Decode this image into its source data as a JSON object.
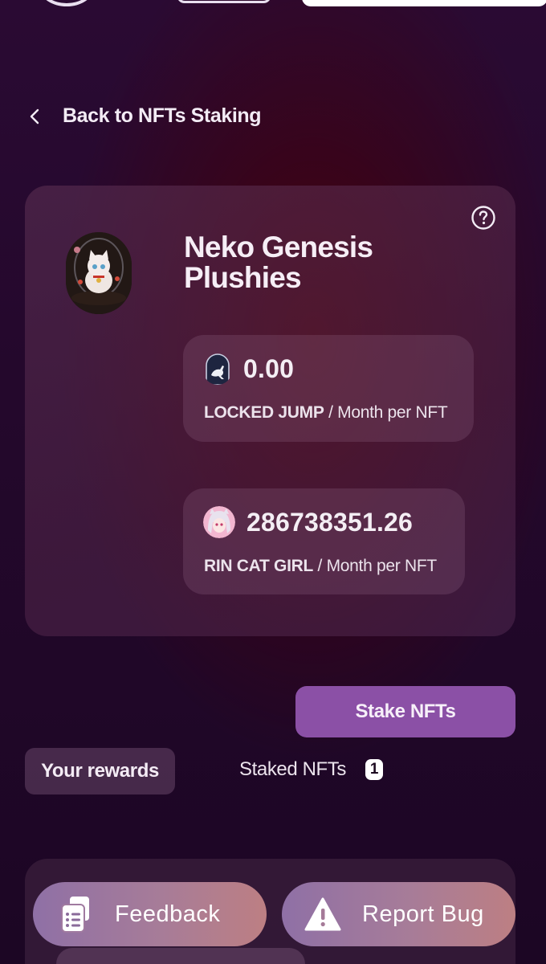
{
  "nav": {
    "back_label": "Back to NFTs Staking"
  },
  "collection": {
    "title": "Neko Genesis Plushies",
    "avatar_icon": "neko-cat-plush-avatar",
    "rewards": [
      {
        "amount": "0.00",
        "token": "LOCKED JUMP",
        "period": " / Month per NFT",
        "icon": "kangaroo-token-icon"
      },
      {
        "amount": "286738351.26",
        "token": "RIN CAT GIRL",
        "period": " / Month per NFT",
        "icon": "cat-girl-token-icon"
      }
    ]
  },
  "actions": {
    "stake_label": "Stake NFTs"
  },
  "tabs": {
    "rewards_label": "Your rewards",
    "staked_label": "Staked NFTs",
    "staked_count": "1"
  },
  "feedback": {
    "feedback_label": "Feedback",
    "report_label": "Report Bug"
  },
  "colors": {
    "accent": "#8b50a6",
    "background": "#24082c"
  }
}
